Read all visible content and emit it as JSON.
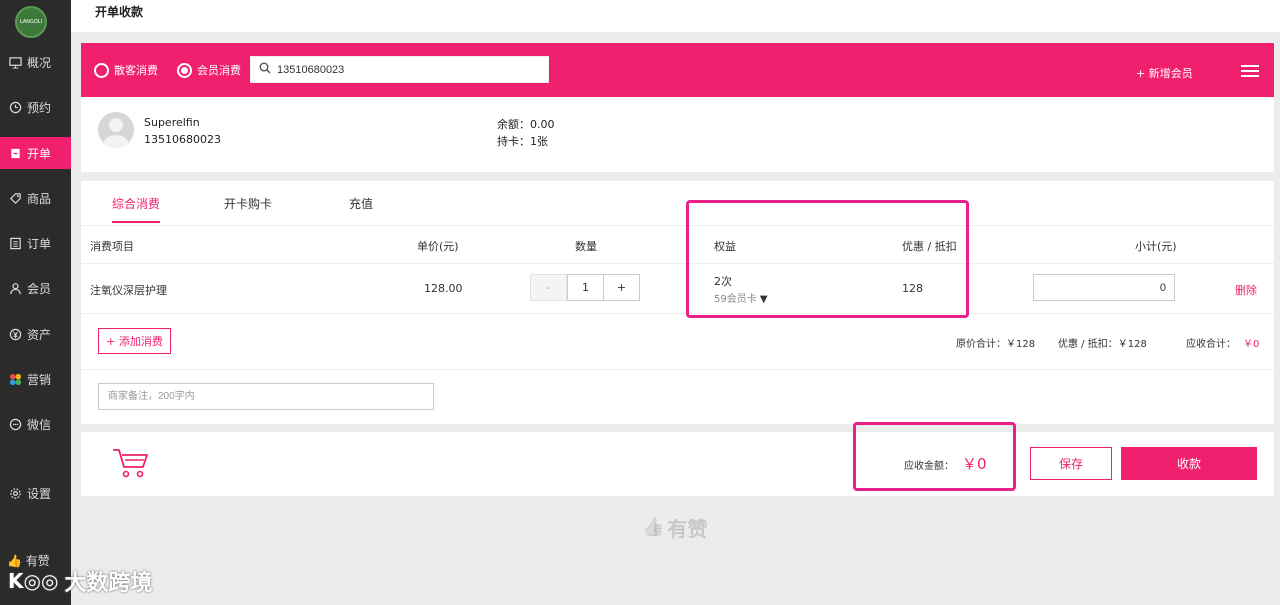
{
  "page_title": "开单收款",
  "logo_text": "LANGOLI",
  "sidebar": {
    "items": [
      {
        "label": "概况",
        "icon": "monitor-icon"
      },
      {
        "label": "预约",
        "icon": "clock-icon"
      },
      {
        "label": "开单",
        "icon": "document-icon"
      },
      {
        "label": "商品",
        "icon": "tag-icon"
      },
      {
        "label": "订单",
        "icon": "list-icon"
      },
      {
        "label": "会员",
        "icon": "user-icon"
      },
      {
        "label": "资产",
        "icon": "yen-icon"
      },
      {
        "label": "营销",
        "icon": "grid-icon"
      },
      {
        "label": "微信",
        "icon": "chat-icon"
      },
      {
        "label": "设置",
        "icon": "gear-icon"
      },
      {
        "label": "有赞",
        "icon": "thumb-icon"
      }
    ],
    "active_index": 2
  },
  "header": {
    "radio_guest": "散客消费",
    "radio_member": "会员消费",
    "search_value": "13510680023",
    "add_member": "+ 新增会员"
  },
  "member": {
    "name": "Superelfin",
    "phone": "13510680023",
    "balance": "余额：0.00",
    "cards": "持卡：1张"
  },
  "tabs": [
    "综合消费",
    "开卡购卡",
    "充值"
  ],
  "table": {
    "headers": {
      "item": "消费项目",
      "unit_price": "单价(元)",
      "quantity": "数量",
      "rights": "权益",
      "discount": "优惠 / 抵扣",
      "subtotal": "小计(元)"
    },
    "row": {
      "item": "注氧仪深层护理",
      "unit_price": "128.00",
      "minus": "-",
      "quantity": "1",
      "plus": "+",
      "rights_count": "2次",
      "card": "59会员卡",
      "discount": "128",
      "subtotal": "0",
      "delete": "删除"
    }
  },
  "add_item": "+ 添加消费",
  "totals": {
    "original": "原价合计：￥128",
    "discount": "优惠 / 抵扣：￥128",
    "due_label": "应收合计：",
    "due_value": "￥0"
  },
  "remark_placeholder": "商家备注，200字内",
  "footer": {
    "due_label": "应收金额：",
    "due_value": "￥0",
    "save": "保存",
    "collect": "收款"
  },
  "watermarks": {
    "youzan": "有赞",
    "site": "大数跨境"
  },
  "colors": {
    "accent": "#f0206f",
    "sidebar_bg": "#2b2b2b",
    "highlight": "#e9208a"
  }
}
